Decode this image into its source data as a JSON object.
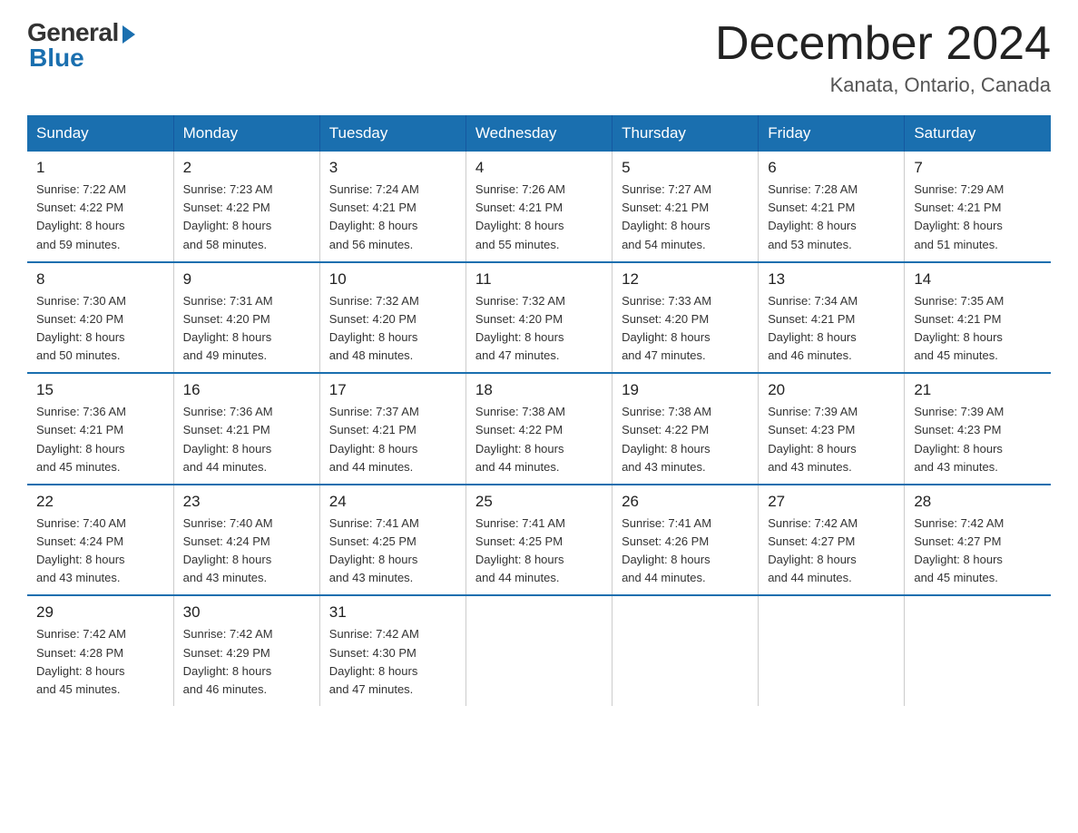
{
  "logo": {
    "general": "General",
    "blue": "Blue"
  },
  "title": "December 2024",
  "location": "Kanata, Ontario, Canada",
  "days_header": [
    "Sunday",
    "Monday",
    "Tuesday",
    "Wednesday",
    "Thursday",
    "Friday",
    "Saturday"
  ],
  "weeks": [
    [
      {
        "day": "1",
        "sunrise": "7:22 AM",
        "sunset": "4:22 PM",
        "daylight": "8 hours and 59 minutes."
      },
      {
        "day": "2",
        "sunrise": "7:23 AM",
        "sunset": "4:22 PM",
        "daylight": "8 hours and 58 minutes."
      },
      {
        "day": "3",
        "sunrise": "7:24 AM",
        "sunset": "4:21 PM",
        "daylight": "8 hours and 56 minutes."
      },
      {
        "day": "4",
        "sunrise": "7:26 AM",
        "sunset": "4:21 PM",
        "daylight": "8 hours and 55 minutes."
      },
      {
        "day": "5",
        "sunrise": "7:27 AM",
        "sunset": "4:21 PM",
        "daylight": "8 hours and 54 minutes."
      },
      {
        "day": "6",
        "sunrise": "7:28 AM",
        "sunset": "4:21 PM",
        "daylight": "8 hours and 53 minutes."
      },
      {
        "day": "7",
        "sunrise": "7:29 AM",
        "sunset": "4:21 PM",
        "daylight": "8 hours and 51 minutes."
      }
    ],
    [
      {
        "day": "8",
        "sunrise": "7:30 AM",
        "sunset": "4:20 PM",
        "daylight": "8 hours and 50 minutes."
      },
      {
        "day": "9",
        "sunrise": "7:31 AM",
        "sunset": "4:20 PM",
        "daylight": "8 hours and 49 minutes."
      },
      {
        "day": "10",
        "sunrise": "7:32 AM",
        "sunset": "4:20 PM",
        "daylight": "8 hours and 48 minutes."
      },
      {
        "day": "11",
        "sunrise": "7:32 AM",
        "sunset": "4:20 PM",
        "daylight": "8 hours and 47 minutes."
      },
      {
        "day": "12",
        "sunrise": "7:33 AM",
        "sunset": "4:20 PM",
        "daylight": "8 hours and 47 minutes."
      },
      {
        "day": "13",
        "sunrise": "7:34 AM",
        "sunset": "4:21 PM",
        "daylight": "8 hours and 46 minutes."
      },
      {
        "day": "14",
        "sunrise": "7:35 AM",
        "sunset": "4:21 PM",
        "daylight": "8 hours and 45 minutes."
      }
    ],
    [
      {
        "day": "15",
        "sunrise": "7:36 AM",
        "sunset": "4:21 PM",
        "daylight": "8 hours and 45 minutes."
      },
      {
        "day": "16",
        "sunrise": "7:36 AM",
        "sunset": "4:21 PM",
        "daylight": "8 hours and 44 minutes."
      },
      {
        "day": "17",
        "sunrise": "7:37 AM",
        "sunset": "4:21 PM",
        "daylight": "8 hours and 44 minutes."
      },
      {
        "day": "18",
        "sunrise": "7:38 AM",
        "sunset": "4:22 PM",
        "daylight": "8 hours and 44 minutes."
      },
      {
        "day": "19",
        "sunrise": "7:38 AM",
        "sunset": "4:22 PM",
        "daylight": "8 hours and 43 minutes."
      },
      {
        "day": "20",
        "sunrise": "7:39 AM",
        "sunset": "4:23 PM",
        "daylight": "8 hours and 43 minutes."
      },
      {
        "day": "21",
        "sunrise": "7:39 AM",
        "sunset": "4:23 PM",
        "daylight": "8 hours and 43 minutes."
      }
    ],
    [
      {
        "day": "22",
        "sunrise": "7:40 AM",
        "sunset": "4:24 PM",
        "daylight": "8 hours and 43 minutes."
      },
      {
        "day": "23",
        "sunrise": "7:40 AM",
        "sunset": "4:24 PM",
        "daylight": "8 hours and 43 minutes."
      },
      {
        "day": "24",
        "sunrise": "7:41 AM",
        "sunset": "4:25 PM",
        "daylight": "8 hours and 43 minutes."
      },
      {
        "day": "25",
        "sunrise": "7:41 AM",
        "sunset": "4:25 PM",
        "daylight": "8 hours and 44 minutes."
      },
      {
        "day": "26",
        "sunrise": "7:41 AM",
        "sunset": "4:26 PM",
        "daylight": "8 hours and 44 minutes."
      },
      {
        "day": "27",
        "sunrise": "7:42 AM",
        "sunset": "4:27 PM",
        "daylight": "8 hours and 44 minutes."
      },
      {
        "day": "28",
        "sunrise": "7:42 AM",
        "sunset": "4:27 PM",
        "daylight": "8 hours and 45 minutes."
      }
    ],
    [
      {
        "day": "29",
        "sunrise": "7:42 AM",
        "sunset": "4:28 PM",
        "daylight": "8 hours and 45 minutes."
      },
      {
        "day": "30",
        "sunrise": "7:42 AM",
        "sunset": "4:29 PM",
        "daylight": "8 hours and 46 minutes."
      },
      {
        "day": "31",
        "sunrise": "7:42 AM",
        "sunset": "4:30 PM",
        "daylight": "8 hours and 47 minutes."
      },
      null,
      null,
      null,
      null
    ]
  ]
}
